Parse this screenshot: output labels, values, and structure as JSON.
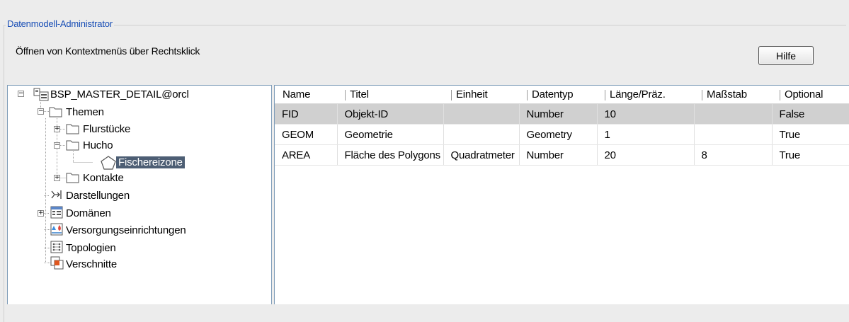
{
  "window": {
    "group_title": "Datenmodell-Administrator",
    "hint": "Öffnen von Kontextmenüs über Rechtsklick",
    "help_label": "Hilfe"
  },
  "tree": {
    "root": "BSP_MASTER_DETAIL@orcl",
    "themen": "Themen",
    "flurstuecke": "Flurstücke",
    "hucho": "Hucho",
    "fischereizone": "Fischereizone",
    "kontakte": "Kontakte",
    "darstellungen": "Darstellungen",
    "domaenen": "Domänen",
    "versorgung": "Versorgungseinrichtungen",
    "topologien": "Topologien",
    "verschnitte": "Verschnitte"
  },
  "grid": {
    "columns": [
      "Name",
      "Titel",
      "Einheit",
      "Datentyp",
      "Länge/Präz.",
      "Maßstab",
      "Optional"
    ],
    "rows": [
      [
        "FID",
        "Objekt-ID",
        "",
        "Number",
        "10",
        "",
        "False"
      ],
      [
        "GEOM",
        "Geometrie",
        "",
        "Geometry",
        "1",
        "",
        "True"
      ],
      [
        "AREA",
        "Fläche des Polygons",
        "Quadratmeter",
        "Number",
        "20",
        "8",
        "True"
      ]
    ],
    "selected_row": 0
  }
}
